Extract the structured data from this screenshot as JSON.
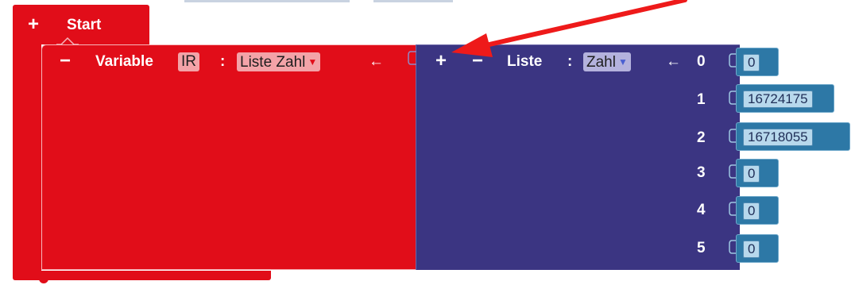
{
  "start_block": {
    "plus": "+",
    "label": "Start"
  },
  "variable_block": {
    "minus": "−",
    "label": "Variable",
    "name": "IR",
    "colon": ":",
    "type": "Liste Zahl",
    "arrow": "←"
  },
  "list_block": {
    "plus": "+",
    "minus": "−",
    "label": "Liste",
    "colon": ":",
    "type": "Zahl",
    "arrow": "←",
    "items": [
      {
        "index": "0",
        "value": "0"
      },
      {
        "index": "1",
        "value": "16724175"
      },
      {
        "index": "2",
        "value": "16718055"
      },
      {
        "index": "3",
        "value": "0"
      },
      {
        "index": "4",
        "value": "0"
      },
      {
        "index": "5",
        "value": "0"
      }
    ]
  },
  "colors": {
    "start_block": "#e10d19",
    "list_block": "#3b3582",
    "number_block": "#2d78a6",
    "annotation_arrow": "#ee1a1a"
  },
  "icons": {
    "dropdown": "triangle-down-icon",
    "annotation": "red-arrow-annotation"
  }
}
